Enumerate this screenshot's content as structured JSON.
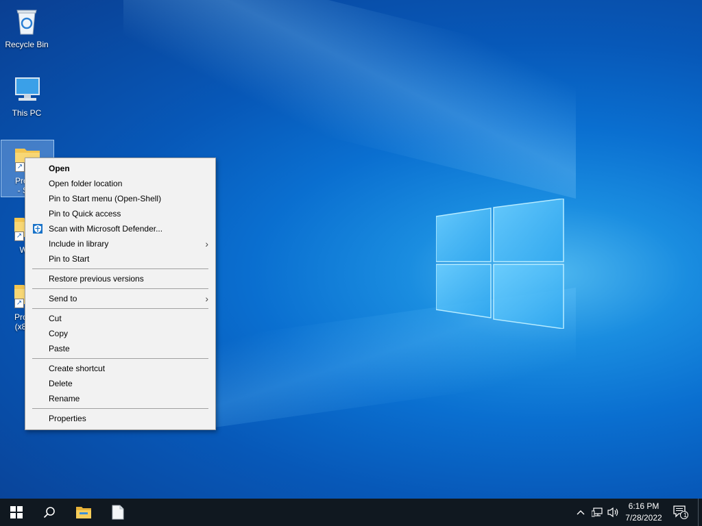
{
  "desktop": {
    "icons": [
      {
        "label": "Recycle Bin"
      },
      {
        "label": "This PC"
      },
      {
        "label_line1": "Progra",
        "label_line2": "- Sho"
      },
      {
        "label": "Win"
      },
      {
        "label_line1": "Progra",
        "label_line2": "(x86) -"
      }
    ]
  },
  "context_menu": {
    "items": [
      {
        "label": "Open"
      },
      {
        "label": "Open folder location"
      },
      {
        "label": "Pin to Start menu (Open-Shell)"
      },
      {
        "label": "Pin to Quick access"
      },
      {
        "label": "Scan with Microsoft Defender..."
      },
      {
        "label": "Include in library",
        "submenu_glyph": "›"
      },
      {
        "label": "Pin to Start"
      },
      {
        "label": "Restore previous versions"
      },
      {
        "label": "Send to",
        "submenu_glyph": "›"
      },
      {
        "label": "Cut"
      },
      {
        "label": "Copy"
      },
      {
        "label": "Paste"
      },
      {
        "label": "Create shortcut"
      },
      {
        "label": "Delete"
      },
      {
        "label": "Rename"
      },
      {
        "label": "Properties"
      }
    ]
  },
  "taskbar": {
    "clock_time": "6:16 PM",
    "clock_date": "7/28/2022",
    "notification_count": "1",
    "icons": [
      "windows-start-icon",
      "search-icon",
      "file-explorer-icon",
      "notepad-icon",
      "chevron-up-icon",
      "network-icon",
      "volume-icon",
      "action-center-icon"
    ]
  },
  "colors": {
    "accent": "#0078d7",
    "taskbar": "#101820",
    "menu_bg": "#f2f2f2"
  }
}
